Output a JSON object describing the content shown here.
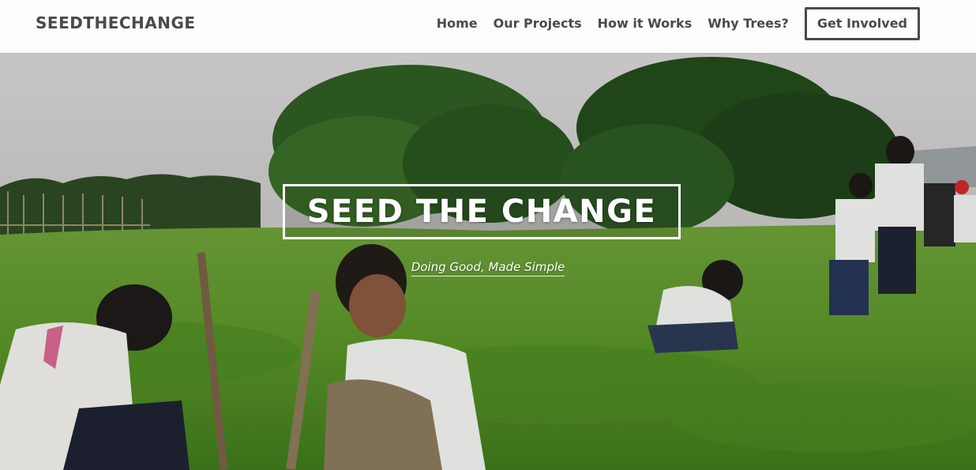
{
  "brand": {
    "name": "SEEDTHECHANGE"
  },
  "nav": {
    "links": [
      {
        "label": "Home"
      },
      {
        "label": "Our Projects"
      },
      {
        "label": "How it Works"
      },
      {
        "label": "Why Trees?"
      }
    ],
    "cta_label": "Get Involved"
  },
  "hero": {
    "title": "SEED THE CHANGE",
    "tagline": "Doing Good, Made Simple",
    "image_subject": "children-planting-trees-in-grass-field"
  },
  "colors": {
    "nav_background": "#fdfdfd",
    "nav_text": "#4a4a4a",
    "hero_text": "#ffffff",
    "grass": "#5f9a2e"
  }
}
